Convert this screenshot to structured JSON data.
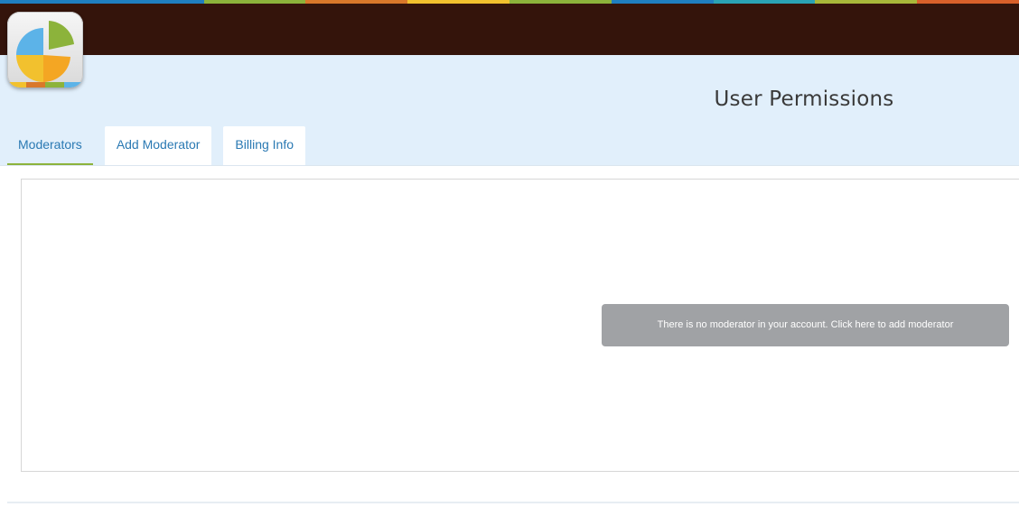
{
  "header": {
    "title": "User Permissions",
    "stripe_colors": [
      "#1f7fc0",
      "#1f7fc0",
      "#8cb33b",
      "#d9782a",
      "#f2c12e",
      "#8cb33b",
      "#1f7fc0",
      "#2aa3b5",
      "#a8b83a",
      "#d9602a"
    ],
    "bar_color": "#34140b",
    "background_color": "#e1effb"
  },
  "logo": {
    "icon": "pie-chart-icon",
    "colors": [
      "#5cb3e8",
      "#f4a623",
      "#8cb33b",
      "#f2c12e"
    ]
  },
  "tabs": [
    {
      "label": "Moderators",
      "active": true
    },
    {
      "label": "Add Moderator",
      "active": false
    },
    {
      "label": "Billing Info",
      "active": false
    }
  ],
  "content": {
    "empty_message": "There is no moderator in your account. Click here to add moderator"
  },
  "accent_color": "#8cb33b",
  "link_color": "#2a79b3"
}
